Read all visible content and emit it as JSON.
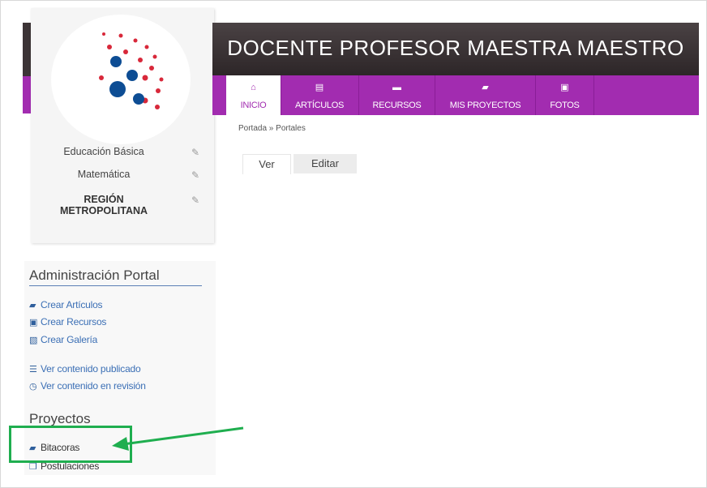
{
  "header": {
    "title": "DOCENTE PROFESOR MAESTRA MAESTRO"
  },
  "nav": {
    "tabs": [
      {
        "label": "INICIO",
        "icon": "home-icon",
        "glyph": "⌂",
        "active": true
      },
      {
        "label": "ARTÍCULOS",
        "icon": "article-icon",
        "glyph": "▤",
        "active": false
      },
      {
        "label": "RECURSOS",
        "icon": "briefcase-icon",
        "glyph": "▬",
        "active": false
      },
      {
        "label": "MIS PROYECTOS",
        "icon": "folder-icon",
        "glyph": "▰",
        "active": false
      },
      {
        "label": "FOTOS",
        "icon": "photo-icon",
        "glyph": "▣",
        "active": false
      }
    ]
  },
  "breadcrumb": "Portada » Portales",
  "content_tabs": {
    "ver": "Ver",
    "editar": "Editar"
  },
  "profile": {
    "level": "Educación Básica",
    "subject": "Matemática",
    "region_line1": "REGIÓN",
    "region_line2": "METROPOLITANA"
  },
  "admin": {
    "title": "Administración Portal",
    "links": [
      {
        "label": "Crear Artículos",
        "icon": "book-icon"
      },
      {
        "label": "Crear Recursos",
        "icon": "save-icon"
      },
      {
        "label": "Crear Galería",
        "icon": "image-icon"
      },
      {
        "label": "Ver contenido publicado",
        "icon": "list-icon"
      },
      {
        "label": "Ver contenido en revisión",
        "icon": "clock-icon"
      }
    ]
  },
  "projects": {
    "title": "Proyectos",
    "links": [
      {
        "label": "Bitacoras",
        "icon": "book-icon"
      },
      {
        "label": "Postulaciones",
        "icon": "copy-icon"
      }
    ]
  },
  "colors": {
    "brand_purple": "#a22cb0",
    "header_dark": "#3c3436",
    "link_blue": "#3b6fb5",
    "annotation_green": "#1fae4f"
  }
}
